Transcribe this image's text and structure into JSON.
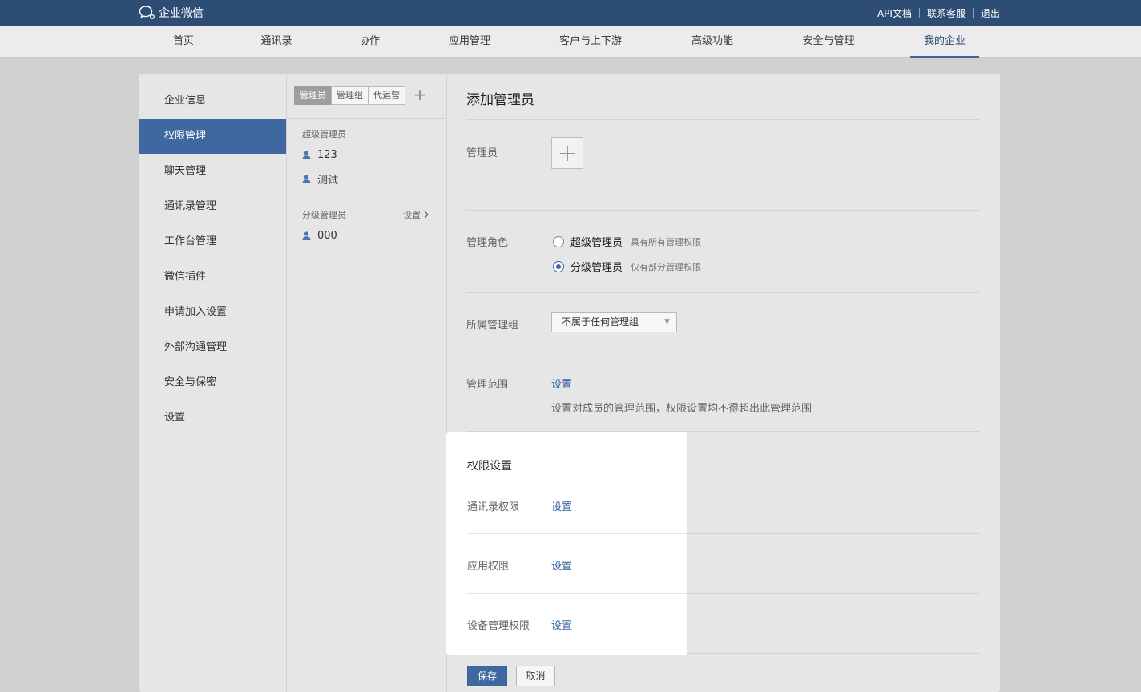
{
  "header": {
    "brand": "企业微信",
    "links": [
      "API文档",
      "联系客服",
      "退出"
    ]
  },
  "nav": {
    "items": [
      "首页",
      "通讯录",
      "协作",
      "应用管理",
      "客户与上下游",
      "高级功能",
      "安全与管理",
      "我的企业"
    ],
    "active": "我的企业"
  },
  "sidebar": {
    "items": [
      "企业信息",
      "权限管理",
      "聊天管理",
      "通讯录管理",
      "工作台管理",
      "微信插件",
      "申请加入设置",
      "外部沟通管理",
      "安全与保密",
      "设置"
    ],
    "active": "权限管理"
  },
  "admin_list": {
    "tabs": [
      "管理员",
      "管理组",
      "代运营"
    ],
    "add_symbol": "+",
    "super_label": "超级管理员",
    "super_users": [
      "123",
      "测试"
    ],
    "sub_label": "分级管理员",
    "sub_setting": "设置",
    "sub_users": [
      "000"
    ]
  },
  "form": {
    "title": "添加管理员",
    "admin_label": "管理员",
    "role_label": "管理角色",
    "roles": [
      {
        "name": "超级管理员",
        "desc": "具有所有管理权限",
        "checked": false
      },
      {
        "name": "分级管理员",
        "desc": "仅有部分管理权限",
        "checked": true
      }
    ],
    "group_label": "所属管理组",
    "group_value": "不属于任何管理组",
    "scope_label": "管理范围",
    "scope_link": "设置",
    "scope_desc": "设置对成员的管理范围，权限设置均不得超出此管理范围"
  },
  "permissions": {
    "title": "权限设置",
    "items": [
      {
        "label": "通讯录权限",
        "link": "设置"
      },
      {
        "label": "应用权限",
        "link": "设置"
      },
      {
        "label": "设备管理权限",
        "link": "设置"
      }
    ]
  },
  "actions": {
    "save": "保存",
    "cancel": "取消"
  },
  "colors": {
    "header_bg": "#2e4d75",
    "accent": "#3f68a0",
    "link": "#2e5e97"
  }
}
